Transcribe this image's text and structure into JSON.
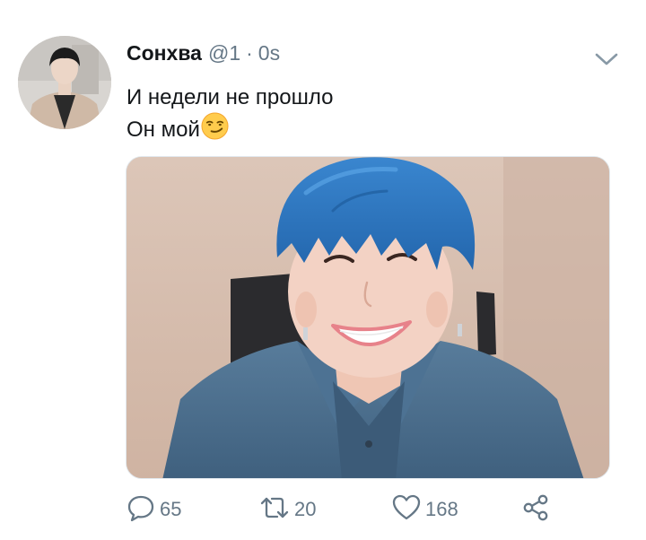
{
  "tweet": {
    "author": {
      "display_name": "Сонхва",
      "handle": "@1",
      "avatar_icon": "avatar-photo"
    },
    "separator": "·",
    "timestamp": "0s",
    "menu_icon": "chevron-down-icon",
    "text_lines": [
      "И недели не прошло",
      "Он мой"
    ],
    "emoji": "smirking-face",
    "media": {
      "kind": "photo",
      "icon": "photo-blue-haired-person"
    },
    "actions": {
      "reply": {
        "icon": "reply-icon",
        "count": "65"
      },
      "retweet": {
        "icon": "retweet-icon",
        "count": "20"
      },
      "like": {
        "icon": "heart-icon",
        "count": "168"
      },
      "share": {
        "icon": "share-icon"
      }
    }
  },
  "colors": {
    "text": "#14171a",
    "secondary": "#657786",
    "hair": "#2f74bd",
    "denim": "#4a6d8c",
    "background_wall": "#d6c1b3"
  }
}
